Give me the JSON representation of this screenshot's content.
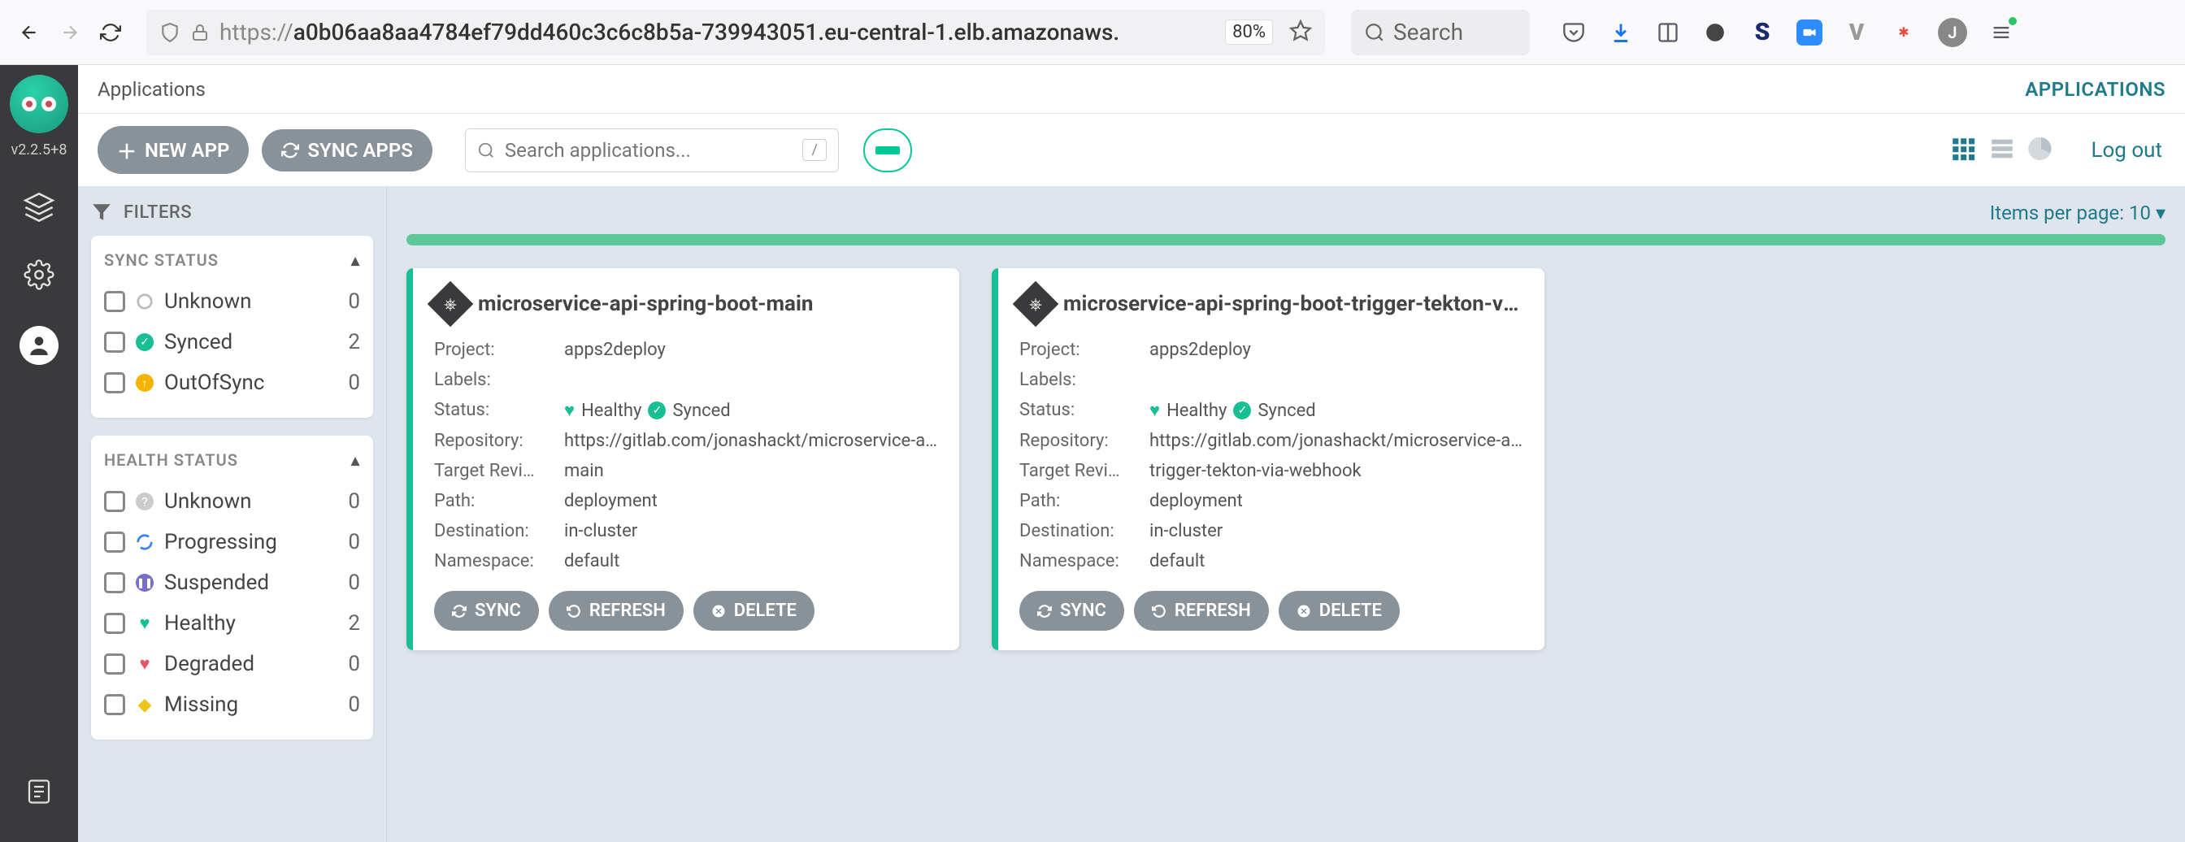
{
  "browser": {
    "url_prefix": "https://",
    "url_host": "a0b06aa8aa4784ef79dd460c3c6c8b5a-739943051.eu-central-1.elb.amazonaws.",
    "zoom": "80%",
    "search_placeholder": "Search",
    "avatar_initial": "J"
  },
  "rail": {
    "version": "v2.2.5+8"
  },
  "breadcrumb": {
    "left": "Applications",
    "right": "APPLICATIONS"
  },
  "toolbar": {
    "new_app": "NEW APP",
    "sync_apps": "SYNC APPS",
    "search_placeholder": "Search applications...",
    "shortcut": "/",
    "logout": "Log out"
  },
  "filters": {
    "title": "FILTERS",
    "sync_status": {
      "title": "SYNC STATUS",
      "items": [
        {
          "label": "Unknown",
          "count": "0",
          "icon": "unknown"
        },
        {
          "label": "Synced",
          "count": "2",
          "icon": "synced"
        },
        {
          "label": "OutOfSync",
          "count": "0",
          "icon": "outofsync"
        }
      ]
    },
    "health_status": {
      "title": "HEALTH STATUS",
      "items": [
        {
          "label": "Unknown",
          "count": "0",
          "icon": "h-unknown"
        },
        {
          "label": "Progressing",
          "count": "0",
          "icon": "h-progressing"
        },
        {
          "label": "Suspended",
          "count": "0",
          "icon": "h-suspended"
        },
        {
          "label": "Healthy",
          "count": "2",
          "icon": "h-healthy"
        },
        {
          "label": "Degraded",
          "count": "0",
          "icon": "h-degraded"
        },
        {
          "label": "Missing",
          "count": "0",
          "icon": "h-missing"
        }
      ]
    }
  },
  "items_per_page": "Items per page: 10",
  "field_labels": {
    "project": "Project:",
    "labels": "Labels:",
    "status": "Status:",
    "repository": "Repository:",
    "target_rev": "Target Revi…",
    "path": "Path:",
    "destination": "Destination:",
    "namespace": "Namespace:"
  },
  "status_text": {
    "healthy": "Healthy",
    "synced": "Synced"
  },
  "card_actions": {
    "sync": "SYNC",
    "refresh": "REFRESH",
    "delete": "DELETE"
  },
  "apps": [
    {
      "name": "microservice-api-spring-boot-main",
      "project": "apps2deploy",
      "labels": "",
      "repository": "https://gitlab.com/jonashackt/microservice-api-s…",
      "target_rev": "main",
      "path": "deployment",
      "destination": "in-cluster",
      "namespace": "default"
    },
    {
      "name": "microservice-api-spring-boot-trigger-tekton-via-w…",
      "project": "apps2deploy",
      "labels": "",
      "repository": "https://gitlab.com/jonashackt/microservice-api-s…",
      "target_rev": "trigger-tekton-via-webhook",
      "path": "deployment",
      "destination": "in-cluster",
      "namespace": "default"
    }
  ]
}
